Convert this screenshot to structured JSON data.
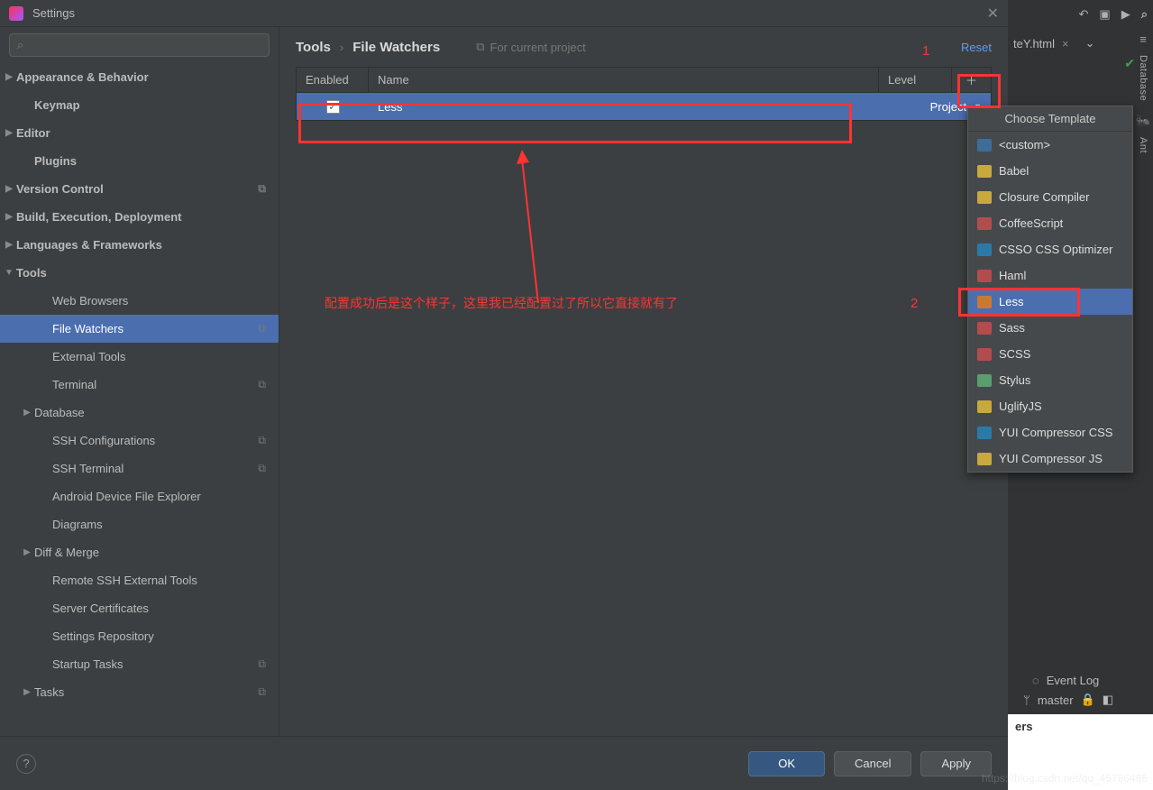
{
  "window": {
    "title": "Settings"
  },
  "sidebar": {
    "search_placeholder": "",
    "items": [
      {
        "label": "Appearance & Behavior",
        "arrow": "▶",
        "bold": true,
        "lv": 0
      },
      {
        "label": "Keymap",
        "bold": true,
        "lv": 0,
        "pad": 1
      },
      {
        "label": "Editor",
        "arrow": "▶",
        "bold": true,
        "lv": 0
      },
      {
        "label": "Plugins",
        "bold": true,
        "lv": 0,
        "pad": 1
      },
      {
        "label": "Version Control",
        "arrow": "▶",
        "bold": true,
        "lv": 0,
        "badge": "⧉"
      },
      {
        "label": "Build, Execution, Deployment",
        "arrow": "▶",
        "bold": true,
        "lv": 0
      },
      {
        "label": "Languages & Frameworks",
        "arrow": "▶",
        "bold": true,
        "lv": 0
      },
      {
        "label": "Tools",
        "arrow": "▼",
        "bold": true,
        "lv": 0
      },
      {
        "label": "Web Browsers",
        "lv": 2
      },
      {
        "label": "File Watchers",
        "lv": 2,
        "selected": true,
        "badge": "⧉"
      },
      {
        "label": "External Tools",
        "lv": 2
      },
      {
        "label": "Terminal",
        "lv": 2,
        "badge": "⧉"
      },
      {
        "label": "Database",
        "arrow": "▶",
        "lv": 1
      },
      {
        "label": "SSH Configurations",
        "lv": 2,
        "badge": "⧉"
      },
      {
        "label": "SSH Terminal",
        "lv": 2,
        "badge": "⧉"
      },
      {
        "label": "Android Device File Explorer",
        "lv": 2
      },
      {
        "label": "Diagrams",
        "lv": 2
      },
      {
        "label": "Diff & Merge",
        "arrow": "▶",
        "lv": 1
      },
      {
        "label": "Remote SSH External Tools",
        "lv": 2
      },
      {
        "label": "Server Certificates",
        "lv": 2
      },
      {
        "label": "Settings Repository",
        "lv": 2
      },
      {
        "label": "Startup Tasks",
        "lv": 2,
        "badge": "⧉"
      },
      {
        "label": "Tasks",
        "arrow": "▶",
        "lv": 1,
        "badge": "⧉"
      }
    ]
  },
  "crumbs": {
    "a": "Tools",
    "b": "File Watchers",
    "scope": "For current project",
    "reset": "Reset"
  },
  "table": {
    "headers": {
      "enabled": "Enabled",
      "name": "Name",
      "level": "Level",
      "add": "＋"
    },
    "row": {
      "name": "Less",
      "level": "Project"
    }
  },
  "menu": {
    "title": "Choose Template",
    "items": [
      {
        "label": "<custom>",
        "cls": "ic-q"
      },
      {
        "label": "Babel",
        "cls": "ic-js"
      },
      {
        "label": "Closure Compiler",
        "cls": "ic-js"
      },
      {
        "label": "CoffeeScript",
        "cls": "ic-rb"
      },
      {
        "label": "CSSO CSS Optimizer",
        "cls": "ic-css"
      },
      {
        "label": "Haml",
        "cls": "ic-rb"
      },
      {
        "label": "Less",
        "cls": "ic-or",
        "sel": true
      },
      {
        "label": "Sass",
        "cls": "ic-rb"
      },
      {
        "label": "SCSS",
        "cls": "ic-rb"
      },
      {
        "label": "Stylus",
        "cls": "ic-gn"
      },
      {
        "label": "UglifyJS",
        "cls": "ic-js"
      },
      {
        "label": "YUI Compressor CSS",
        "cls": "ic-css"
      },
      {
        "label": "YUI Compressor JS",
        "cls": "ic-js"
      }
    ]
  },
  "footer": {
    "ok": "OK",
    "cancel": "Cancel",
    "apply": "Apply"
  },
  "right": {
    "tab": "teY.html",
    "sidelabels": [
      "Database",
      "Ant"
    ],
    "eventlog": "Event Log",
    "branch": "master",
    "whitetext": "ers",
    "watermark": "https://blog.csdn.net/qq_45796486"
  },
  "annot": {
    "n1": "1",
    "n2": "2",
    "text": "配置成功后是这个样子，这里我已经配置过了所以它直接就有了"
  }
}
